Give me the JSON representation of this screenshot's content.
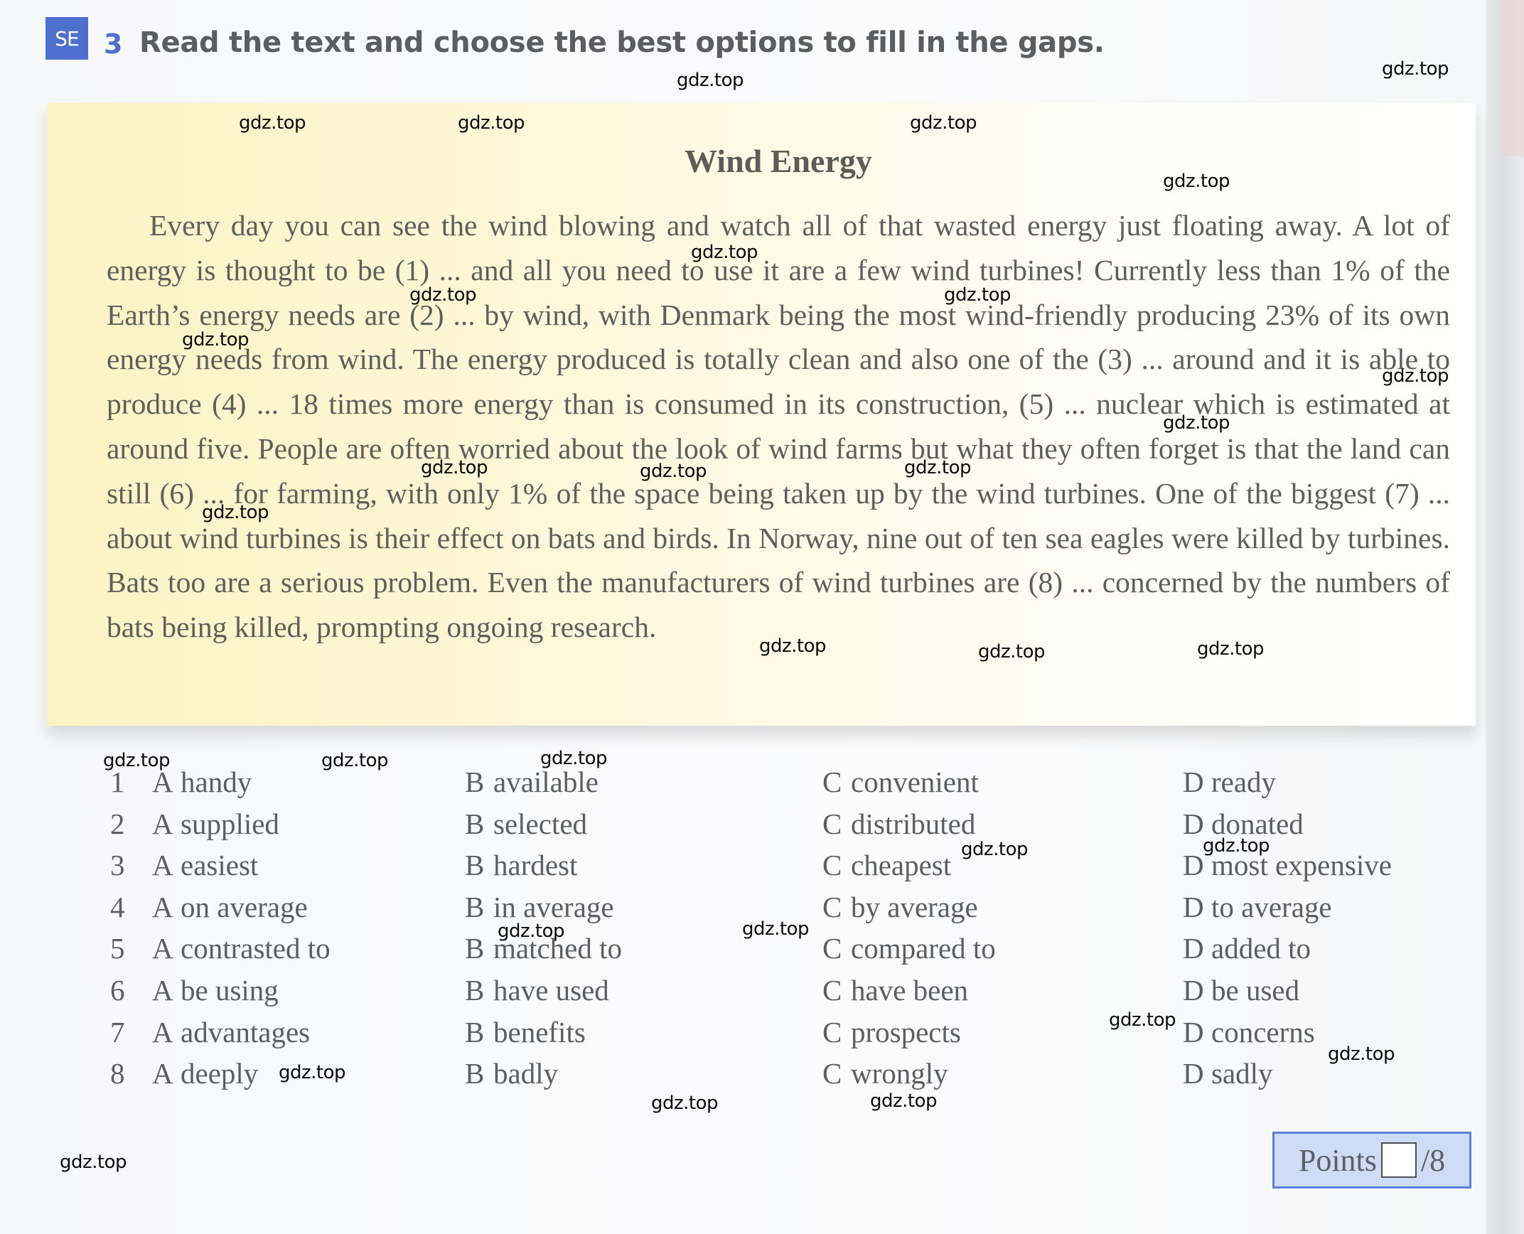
{
  "header": {
    "badge": "SE",
    "task_number": "3",
    "instruction": "Read the text and choose the best options to fill in the gaps."
  },
  "passage": {
    "title": "Wind Energy",
    "text": "Every day you can see the wind blowing and watch all of that wasted energy just floating away. A lot of energy is thought to be (1) ... and all you need to use it are a few wind turbines! Currently less than 1% of the Earth’s energy needs are (2) ... by wind, with Denmark being the most wind-friendly producing 23% of its own energy needs from wind. The energy produced is totally clean and also one of the (3) ... around and it is able to produce (4) ... 18 times more energy than is consumed in its construction, (5) ... nuclear which is estimated at around five. People are often worried about the look of wind farms but what they often forget is that the land can still (6) ... for farming, with only 1% of the space being taken up by the wind turbines. One of the biggest (7) ... about wind turbines is their effect on bats and birds. In Norway, nine out of  ten sea eagles were killed by turbines. Bats too are a serious problem. Even the manufacturers of wind turbines are (8) ... concerned by the numbers of bats being killed, prompting ongoing research."
  },
  "options": [
    {
      "num": "1",
      "A": "handy",
      "B": "available",
      "C": "convenient",
      "D": "ready"
    },
    {
      "num": "2",
      "A": "supplied",
      "B": "selected",
      "C": "distributed",
      "D": "donated"
    },
    {
      "num": "3",
      "A": "easiest",
      "B": "hardest",
      "C": "cheapest",
      "D": "most expensive"
    },
    {
      "num": "4",
      "A": "on average",
      "B": "in average",
      "C": "by average",
      "D": "to average"
    },
    {
      "num": "5",
      "A": "contrasted to",
      "B": "matched to",
      "C": "compared to",
      "D": "added to"
    },
    {
      "num": "6",
      "A": "be using",
      "B": "have used",
      "C": "have been",
      "D": "be used"
    },
    {
      "num": "7",
      "A": "advantages",
      "B": "benefits",
      "C": "prospects",
      "D": "concerns"
    },
    {
      "num": "8",
      "A": "deeply",
      "B": "badly",
      "C": "wrongly",
      "D": "sadly"
    }
  ],
  "option_letters": {
    "A": "A",
    "B": "B",
    "C": "C",
    "D": "D"
  },
  "points": {
    "label": "Points",
    "value": "",
    "max": "/8"
  },
  "watermark": "gdz.top",
  "colors": {
    "badge": "#4f6fcf",
    "task_number": "#4c6fd0",
    "points_bg": "#cfdcf6",
    "points_border": "#5a7fd6"
  }
}
